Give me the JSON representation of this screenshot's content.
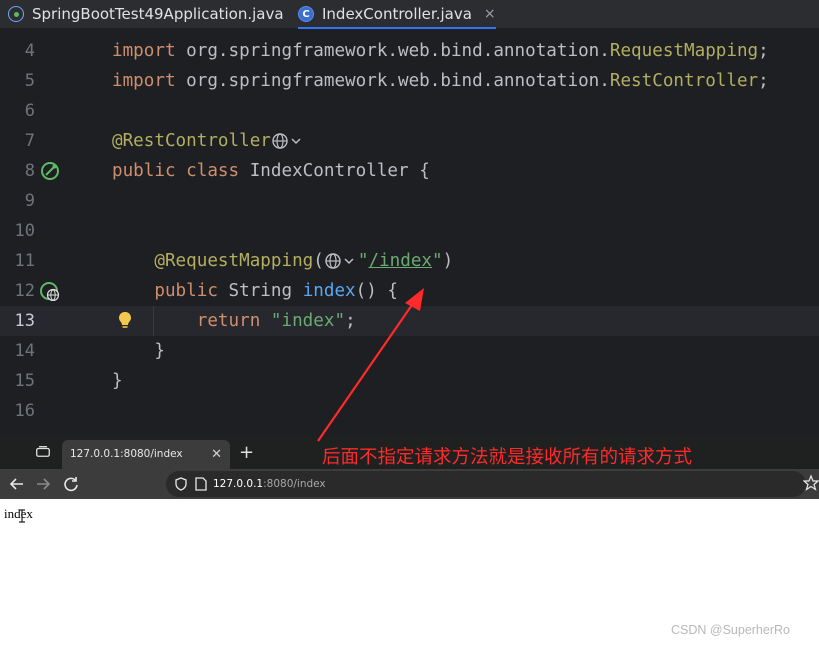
{
  "ide": {
    "tabs": [
      {
        "label": "SpringBootTest49Application.java",
        "icon": "spring-boot-class-icon",
        "active": false
      },
      {
        "label": "IndexController.java",
        "icon": "java-class-icon",
        "active": true,
        "close": "×"
      }
    ],
    "editor": {
      "current_line": "13",
      "lines": [
        {
          "number": "4",
          "import_kw": "import",
          "pkg": " org.springframework.web.bind.annotation.",
          "ann": "RequestMapping",
          "end": ";"
        },
        {
          "number": "5",
          "import_kw": "import",
          "pkg": " org.springframework.web.bind.annotation.",
          "ann": "RestController",
          "end": ";"
        },
        {
          "number": "6"
        },
        {
          "number": "7",
          "ann": "@RestController"
        },
        {
          "number": "8",
          "kw1": "public",
          "kw2": "class",
          "name": " IndexController {"
        },
        {
          "number": "9"
        },
        {
          "number": "10"
        },
        {
          "number": "11",
          "ann": "@RequestMapping",
          "open": "(",
          "q1": "\"",
          "path": "/index",
          "q2": "\"",
          "close": ")"
        },
        {
          "number": "12",
          "kw": "public",
          "type": " String ",
          "method": "index",
          "rest": "() {"
        },
        {
          "number": "13",
          "kw": "return",
          "str": "\"index\"",
          "end": ";"
        },
        {
          "number": "14",
          "text": "}"
        },
        {
          "number": "15",
          "text": "}"
        },
        {
          "number": "16"
        }
      ]
    }
  },
  "browser": {
    "tab_title": "127.0.0.1:8080/index",
    "tab_close": "✕",
    "new_tab": "+",
    "url_host": "127.0.0.1",
    "url_rest": ":8080/index",
    "page_text": "index"
  },
  "annotation": {
    "text": "后面不指定请求方法就是接收所有的请求方式",
    "color": "#ff2a2a"
  },
  "watermark": "CSDN @SuperherRo",
  "colors": {
    "editor_bg": "#1e1f22",
    "keyword": "#cf8e6d",
    "annotation": "#b3ae60",
    "string": "#6aab73",
    "function": "#56a8f5",
    "tab_active_underline": "#3574f0"
  }
}
